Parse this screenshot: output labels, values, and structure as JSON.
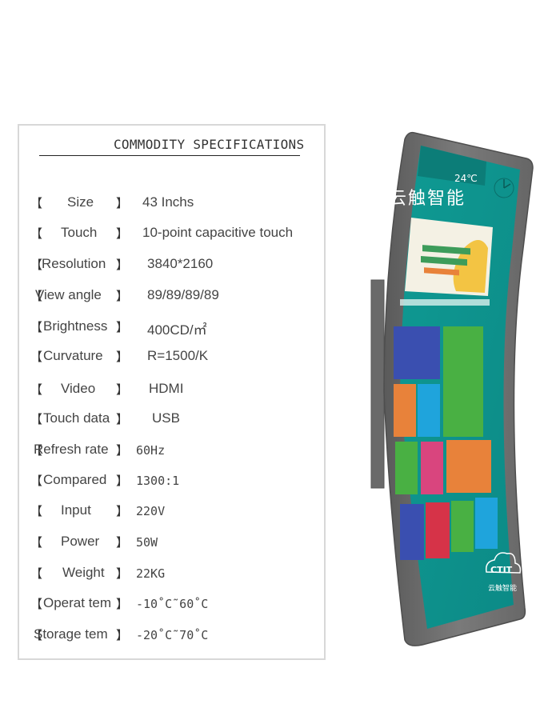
{
  "spec_panel": {
    "title": "COMMODITY SPECIFICATIONS",
    "bracket_open": "【",
    "bracket_close": "】",
    "rows": [
      {
        "label": "Size",
        "value": "43 Inchs"
      },
      {
        "label": "Touch",
        "value": "10-point capacitive touch"
      },
      {
        "label": "Resolution",
        "value": "3840*2160"
      },
      {
        "label": "View angle",
        "value": "89/89/89/89"
      },
      {
        "label": "Brightness",
        "value": "400CD/㎡"
      },
      {
        "label": "Curvature",
        "value": "R=1500/K"
      },
      {
        "label": "Video",
        "value": "HDMI"
      },
      {
        "label": "Touch data",
        "value": "USB"
      },
      {
        "label": "Refresh rate",
        "value": "60Hz"
      },
      {
        "label": "Compared",
        "value": "1300:1"
      },
      {
        "label": "Input",
        "value": "220V"
      },
      {
        "label": "Power",
        "value": "50W"
      },
      {
        "label": "Weight",
        "value": "22KG"
      },
      {
        "label": "Operat tem",
        "value": "-10˚C˜60˚C"
      },
      {
        "label": "Storage tem",
        "value": "-20˚C˜70˚C"
      }
    ]
  },
  "device": {
    "brand_text": "云触智能",
    "temperature": "24℃",
    "logo_text": "CTIT",
    "logo_subtext": "云触智能",
    "colors": {
      "frame": "#6f6f6f",
      "screen": "#11958f",
      "tile_blue": "#3a4fb0",
      "tile_green": "#49b043",
      "tile_orange": "#e8823a",
      "tile_sky": "#1fa4dc",
      "tile_pink": "#d9457e",
      "tile_red": "#d63348",
      "banner": "#f4f1e4"
    }
  }
}
